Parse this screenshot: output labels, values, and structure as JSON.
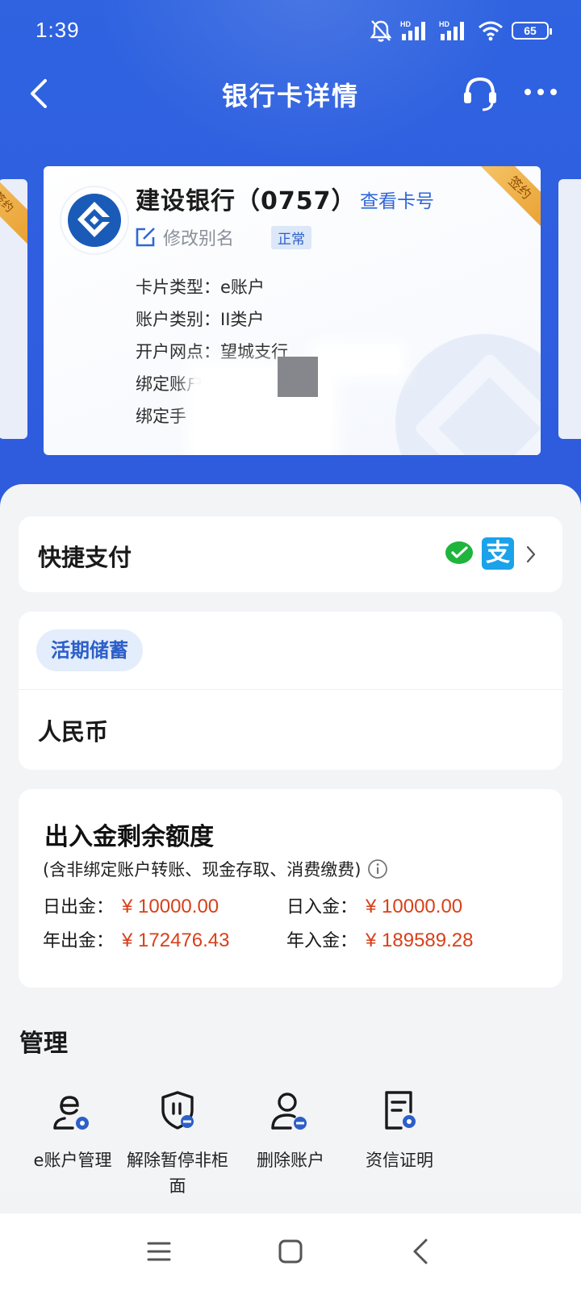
{
  "status_bar": {
    "time": "1:39",
    "battery": "65",
    "net_1": "HD",
    "net_2": "HD"
  },
  "navbar": {
    "title": "银行卡详情"
  },
  "card": {
    "bank_name": "建设银行（0757）",
    "view_card_no": "查看卡号",
    "edit_alias": "修改别名",
    "status": "正常",
    "ribbon": "签约",
    "side_ribbon": "签约",
    "info": [
      "卡片类型：e账户",
      "账户类别：II类户",
      "开户网点：望城支行",
      "绑定账户",
      "绑定手"
    ]
  },
  "quick_pay": {
    "label": "快捷支付",
    "alipay_glyph": "支"
  },
  "deposit": {
    "tag": "活期储蓄",
    "currency": "人民币"
  },
  "limits": {
    "title": "出入金剩余额度",
    "subtitle": "(含非绑定账户转账、现金存取、消费缴费)",
    "items": [
      {
        "label": "日出金：",
        "amount": "¥ 10000.00"
      },
      {
        "label": "日入金：",
        "amount": "¥ 10000.00"
      },
      {
        "label": "年出金：",
        "amount": "¥ 172476.43"
      },
      {
        "label": "年入金：",
        "amount": "¥ 189589.28"
      }
    ],
    "amount_color": "#d8401a"
  },
  "manage": {
    "title": "管理",
    "items": [
      {
        "label": "e账户管理",
        "icon": "e-account-gear-icon"
      },
      {
        "label": "解除暂停非柜面",
        "icon": "shield-pause-icon"
      },
      {
        "label": "删除账户",
        "icon": "user-minus-icon"
      },
      {
        "label": "资信证明",
        "icon": "document-icon"
      }
    ]
  },
  "colors": {
    "primary_blue": "#2f63e0",
    "link_blue": "#2f67d8",
    "icon_blue": "#2d5fc8"
  }
}
